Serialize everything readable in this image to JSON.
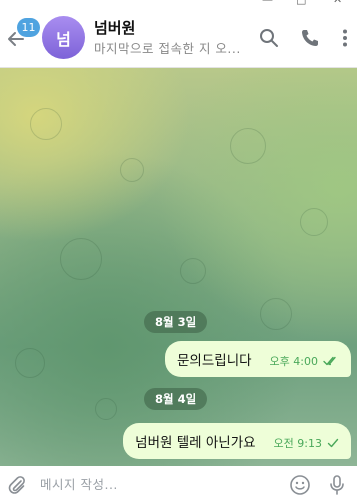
{
  "header": {
    "unread_count": "11",
    "avatar_initial": "넘",
    "title": "넘버원",
    "status": "마지막으로 접속한 지 오..."
  },
  "messages": [
    {
      "type": "date",
      "label": "8월 3일"
    },
    {
      "type": "outgoing",
      "text": "문의드립니다",
      "time": "오후 4:00",
      "status": "read"
    },
    {
      "type": "date",
      "label": "8월 4일"
    },
    {
      "type": "outgoing",
      "text": "넘버원 텔레 아닌가요",
      "time": "오전 9:13",
      "status": "sent"
    }
  ],
  "composer": {
    "placeholder": "메시지 작성..."
  },
  "colors": {
    "accent": "#4fa3e0",
    "outgoing_bubble": "#eefed8",
    "time_green": "#4aa85a"
  }
}
